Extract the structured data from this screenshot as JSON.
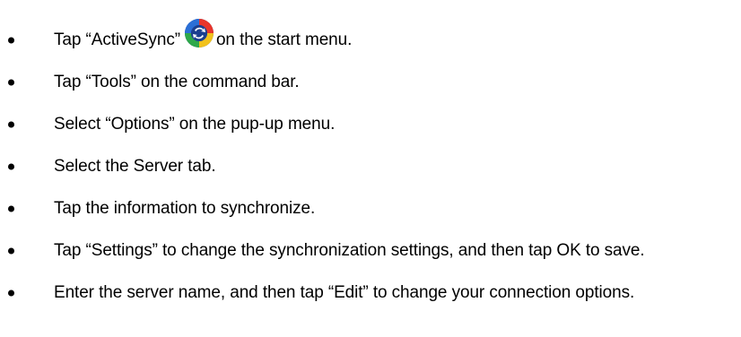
{
  "instructions": [
    {
      "text_before": "Tap “ActiveSync”",
      "icon": "activesync-icon",
      "text_after": "on the start menu."
    },
    {
      "text": "Tap “Tools” on the command bar."
    },
    {
      "text": "Select “Options” on the pup-up menu."
    },
    {
      "text": "Select the Server tab."
    },
    {
      "text": "Tap the information to synchronize."
    },
    {
      "text": "Tap “Settings” to change the synchronization settings, and then tap OK to save."
    },
    {
      "text": "Enter the server name, and then tap “Edit” to change your connection options."
    }
  ],
  "colors": {
    "text": "#000000",
    "background": "#ffffff",
    "icon_ring_red": "#e8352b",
    "icon_ring_blue": "#2b6fd6",
    "icon_ring_yellow": "#f2c21b",
    "icon_ring_green": "#2ea84a",
    "icon_center": "#1b3f8f"
  }
}
